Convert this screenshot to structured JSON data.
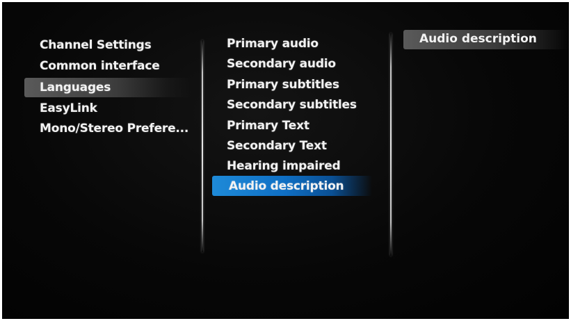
{
  "menu": {
    "items": [
      {
        "label": "Channel Settings"
      },
      {
        "label": "Common interface"
      },
      {
        "label": "Languages"
      },
      {
        "label": "EasyLink"
      },
      {
        "label": "Mono/Stereo Prefere..."
      }
    ]
  },
  "languages_menu": {
    "items": [
      {
        "label": "Primary audio"
      },
      {
        "label": "Secondary audio"
      },
      {
        "label": "Primary subtitles"
      },
      {
        "label": "Secondary subtitles"
      },
      {
        "label": "Primary Text"
      },
      {
        "label": "Secondary Text"
      },
      {
        "label": "Hearing impaired"
      },
      {
        "label": "Audio description"
      }
    ]
  },
  "detail": {
    "title": "Audio description"
  },
  "colors": {
    "focus_highlight": "#1e8ad8",
    "parent_highlight": "#4a4a4a",
    "background": "#050505",
    "text": "#f2f2f2"
  }
}
